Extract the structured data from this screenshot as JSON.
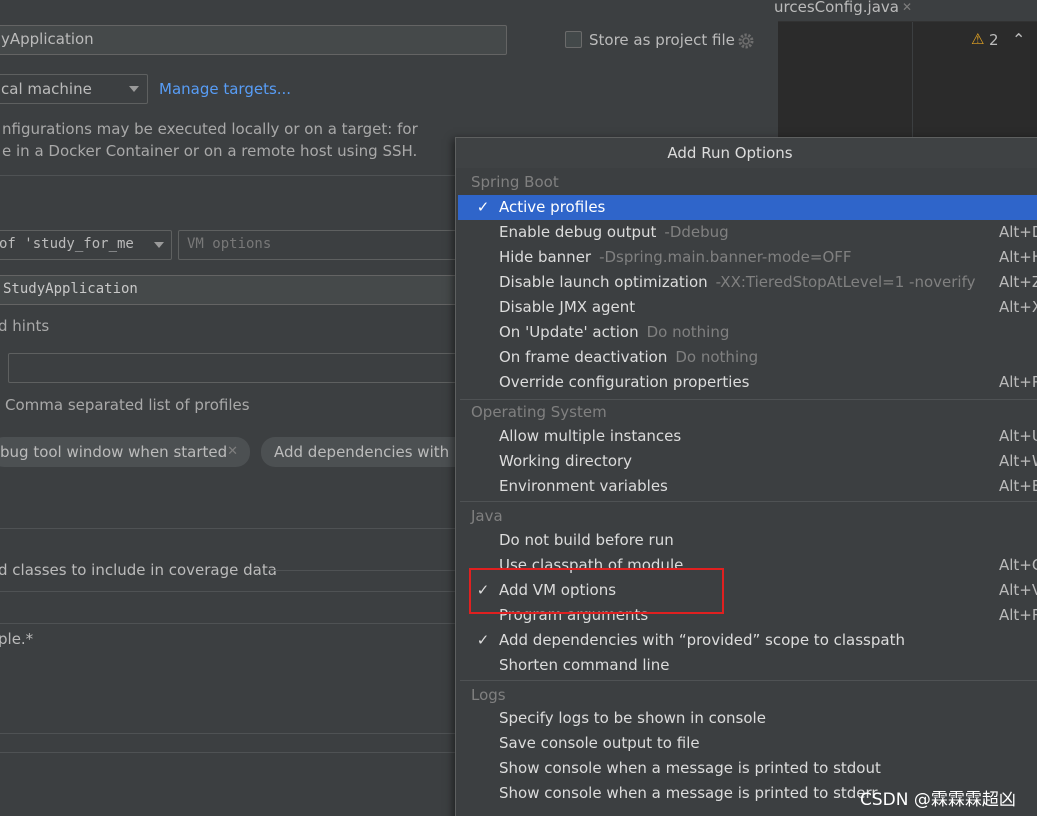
{
  "editor": {
    "tab_label": "urcesConfig.java",
    "tab_close": "✕",
    "warning_icon": "⚠",
    "warning_count": "2",
    "collapse_icon": "⌃"
  },
  "config": {
    "name_value": "yApplication",
    "store_as_project_file": "Store as project file",
    "run_on_value": "cal machine",
    "manage_targets": "Manage targets...",
    "run_on_help_line1": "nfigurations may be executed locally or on a target: for",
    "run_on_help_line2": "e in a Docker Container or on a remote host using SSH.",
    "jre_value": "of 'study_for_me",
    "vm_options_placeholder": "VM options",
    "main_class_value": "StudyApplication",
    "hints_label": "d hints",
    "profiles_value": "",
    "profiles_help": "Comma separated list of profiles",
    "chip_debug_window": "bug tool window when started",
    "chip_close": "✕",
    "chip_add_dependencies": "Add dependencies with “",
    "coverage_label": "d classes to include in coverage data",
    "coverage_pattern": "ple.*"
  },
  "popup": {
    "title": "Add Run Options",
    "check_mark": "✓",
    "groups": [
      {
        "name": "Spring Boot",
        "items": [
          {
            "label": "Active profiles",
            "hint": "",
            "shortcut": "",
            "checked": true,
            "selected": true
          },
          {
            "label": "Enable debug output",
            "hint": "-Ddebug",
            "shortcut": "Alt+D",
            "checked": false,
            "selected": false
          },
          {
            "label": "Hide banner",
            "hint": "-Dspring.main.banner-mode=OFF",
            "shortcut": "Alt+H",
            "checked": false,
            "selected": false
          },
          {
            "label": "Disable launch optimization",
            "hint": "-XX:TieredStopAtLevel=1 -noverify",
            "shortcut": "Alt+Z",
            "checked": false,
            "selected": false
          },
          {
            "label": "Disable JMX agent",
            "hint": "",
            "shortcut": "Alt+X",
            "checked": false,
            "selected": false
          },
          {
            "label": "On 'Update' action",
            "hint": "Do nothing",
            "shortcut": "",
            "checked": false,
            "selected": false
          },
          {
            "label": "On frame deactivation",
            "hint": "Do nothing",
            "shortcut": "",
            "checked": false,
            "selected": false
          },
          {
            "label": "Override configuration properties",
            "hint": "",
            "shortcut": "Alt+P",
            "checked": false,
            "selected": false
          }
        ]
      },
      {
        "name": "Operating System",
        "items": [
          {
            "label": "Allow multiple instances",
            "hint": "",
            "shortcut": "Alt+U",
            "checked": false,
            "selected": false
          },
          {
            "label": "Working directory",
            "hint": "",
            "shortcut": "Alt+W",
            "checked": false,
            "selected": false
          },
          {
            "label": "Environment variables",
            "hint": "",
            "shortcut": "Alt+E",
            "checked": false,
            "selected": false
          }
        ]
      },
      {
        "name": "Java",
        "items": [
          {
            "label": "Do not build before run",
            "hint": "",
            "shortcut": "",
            "checked": false,
            "selected": false
          },
          {
            "label": "Use classpath of module",
            "hint": "",
            "shortcut": "Alt+O",
            "checked": false,
            "selected": false
          },
          {
            "label": "Add VM options",
            "hint": "",
            "shortcut": "Alt+V",
            "checked": true,
            "selected": false
          },
          {
            "label": "Program arguments",
            "hint": "",
            "shortcut": "Alt+R",
            "checked": false,
            "selected": false
          },
          {
            "label": "Add dependencies with “provided” scope to classpath",
            "hint": "",
            "shortcut": "",
            "checked": true,
            "selected": false
          },
          {
            "label": "Shorten command line",
            "hint": "",
            "shortcut": "",
            "checked": false,
            "selected": false
          }
        ]
      },
      {
        "name": "Logs",
        "items": [
          {
            "label": "Specify logs to be shown in console",
            "hint": "",
            "shortcut": "",
            "checked": false,
            "selected": false
          },
          {
            "label": "Save console output to file",
            "hint": "",
            "shortcut": "",
            "checked": false,
            "selected": false
          },
          {
            "label": "Show console when a message is printed to stdout",
            "hint": "",
            "shortcut": "",
            "checked": false,
            "selected": false
          },
          {
            "label": "Show console when a message is printed to stderr",
            "hint": "",
            "shortcut": "",
            "checked": false,
            "selected": false
          }
        ]
      }
    ]
  },
  "watermark": "CSDN @霖霖霖超凶",
  "colors": {
    "selection": "#2f65ca",
    "annotation_box": "#e02020",
    "link": "#589df6",
    "warning": "#e5a422"
  }
}
